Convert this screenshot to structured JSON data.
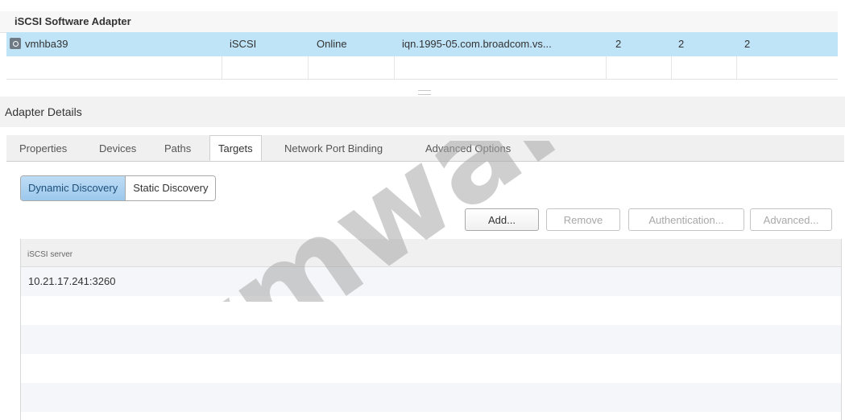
{
  "adapter_section": {
    "title": "iSCSI Software Adapter",
    "adapter": {
      "name": "vmhba39",
      "type": "iSCSI",
      "status": "Online",
      "iqn": "iqn.1995-05.com.broadcom.vs...",
      "targets": "2",
      "devices": "2",
      "paths": "2"
    }
  },
  "details": {
    "title": "Adapter Details",
    "tabs": [
      {
        "label": "Properties"
      },
      {
        "label": "Devices"
      },
      {
        "label": "Paths"
      },
      {
        "label": "Targets"
      },
      {
        "label": "Network Port Binding"
      },
      {
        "label": "Advanced Options"
      }
    ],
    "active_tab": "Targets",
    "discovery": {
      "dynamic_label": "Dynamic Discovery",
      "static_label": "Static Discovery",
      "selected": "Dynamic Discovery"
    },
    "actions": {
      "add_label": "Add...",
      "remove_label": "Remove",
      "authentication_label": "Authentication...",
      "advanced_label": "Advanced..."
    },
    "server_list": {
      "header": "iSCSI server",
      "rows": [
        "10.21.17.241:3260"
      ]
    }
  },
  "watermark": {
    "text": "vmware",
    "mark": "®"
  },
  "colors": {
    "selected_row": "#bfe3f7",
    "segment_active": "#9cc8ec",
    "tab_bar": "#f0f0f0",
    "disabled_text": "#a8a8a8"
  }
}
